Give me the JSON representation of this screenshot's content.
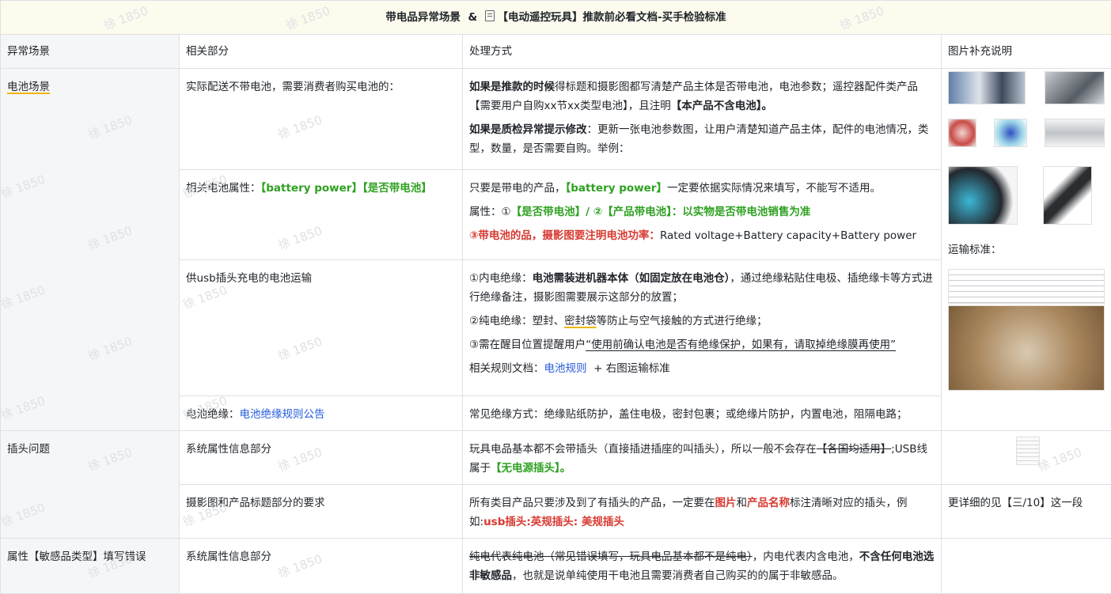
{
  "header": {
    "part1": "带电品异常场景",
    "amp": "&",
    "doc_link": "【电动遥控玩具】推款前必看文档-买手检验标准"
  },
  "columns": [
    "异常场景",
    "相关部分",
    "处理方式",
    "图片补充说明"
  ],
  "watermark": "徐 1850",
  "rows": {
    "battery": {
      "scene": "电池场景",
      "r1": {
        "part": "实际配送不带电池，需要消费者购买电池的：",
        "p1_b": "如果是推款的时候",
        "p1_t": "得标题和摄影图都写清楚产品主体是否带电池，电池参数；遥控器配件类产品【需要用户自购xx节xx类型电池】，且注明",
        "p1_b2": "【本产品不含电池】。",
        "p2_b": "如果是质检异常提示修改",
        "p2_t": "：更新一张电池参数图，让用户清楚知道产品主体，配件的电池情况，类型，数量，是否需要自购。举例："
      },
      "r2": {
        "part_pre": "相关电池属性：",
        "part_green": "【battery power】【是否带电池】",
        "l1_pre": "只要是带电的产品，",
        "l1_green": "【battery power】",
        "l1_post": "一定要依据实际情况来填写，不能写不适用。",
        "l2_pre": "属性：①",
        "l2_green1": "【是否带电池】/ ②",
        "l2_green2": "【产品带电池】：以实物是否带电池销售为准",
        "l3_red": "③带电池的品，摄影图要注明电池功率：",
        "l3_post": "Rated voltage+Battery capacity+Battery power"
      },
      "r3": {
        "part": "供usb插头充电的电池运输",
        "a_pre": "①内电绝缘：",
        "a_b": "电池需装进机器本体（如固定放在电池仓）",
        "a_post": "，通过绝缘粘贴住电极、插绝缘卡等方式进行绝缘备注，摄影图需要展示这部分的放置；",
        "b_pre": "②纯电绝缘：塑封、",
        "b_u": "密封袋",
        "b_post": "等防止与空气接触的方式进行绝缘；",
        "c_pre": "③需在醒目位置提醒用户",
        "c_u": "“使用前确认电池是否有绝缘保护，如果有，请取掉绝缘膜再使用”",
        "d_pre": "相关规则文档：",
        "d_link": "电池规则",
        "d_post": "+ 右图运输标准"
      },
      "r4": {
        "part_pre": "电池绝缘：",
        "part_link": "电池绝缘规则公告",
        "method": "常见绝缘方式：绝缘贴纸防护，盖住电极，密封包裹；或绝缘片防护，内置电池，阻隔电路；"
      },
      "image_caption": "运输标准："
    },
    "plug": {
      "scene": "插头问题",
      "r1": {
        "part": "系统属性信息部分",
        "t1": "玩具电品基本都不会带插头（直接插进插座的叫插头），所以一般不会存在",
        "t_strike": "【各国均适用】",
        "t2": ";USB线属于",
        "t_green": "【无电源插头】。"
      },
      "r2": {
        "part": "摄影图和产品标题部分的要求",
        "t1": "所有类目产品只要涉及到了有插头的产品，一定要在",
        "t_red1": "图片",
        "t2": "和",
        "t_red2": "产品名称",
        "t3": "标注清晰对应的插头，例如:",
        "t_red3": "usb插头:英规插头: 美规插头",
        "img_note": "更详细的见【三/10】这一段"
      }
    },
    "attr": {
      "scene": "属性【敏感品类型】填写错误",
      "r1": {
        "part": "系统属性信息部分",
        "t_strike": "纯电代表纯电池（常见错误填写，玩具电品基本都不是纯电）",
        "t1": "，内电代表内含电池，",
        "t_b1": "不含任何电池选非敏感品",
        "t2": "，也就是说单纯使用干电池且需要消费者自己购买的的属于非敏感品。"
      }
    }
  }
}
